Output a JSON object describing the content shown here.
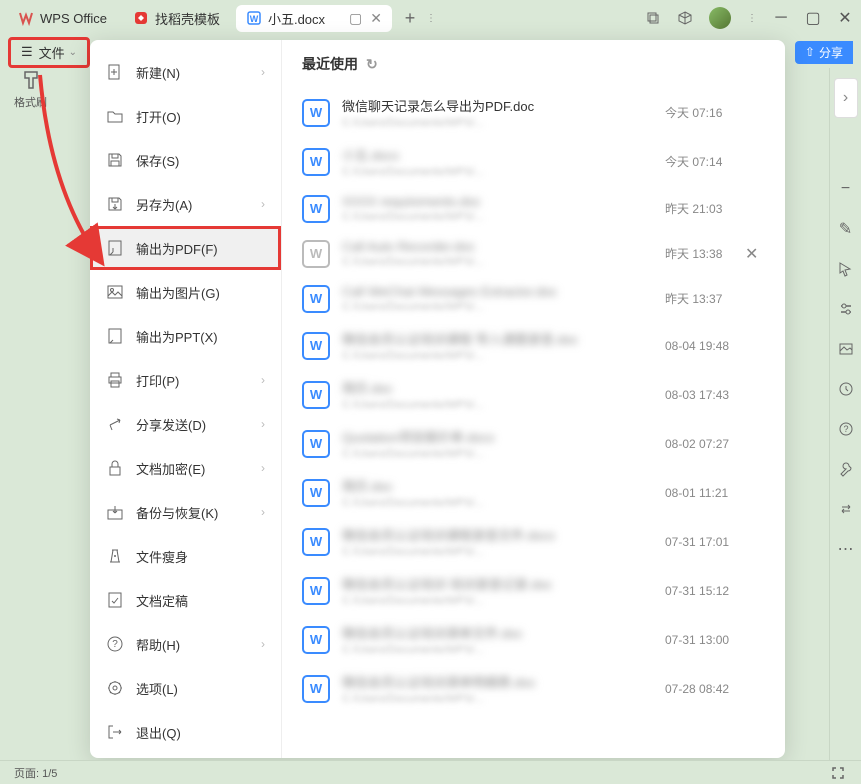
{
  "tabs": [
    {
      "label": "WPS Office",
      "icon": "wps"
    },
    {
      "label": "找稻壳模板",
      "icon": "docer"
    },
    {
      "label": "小五.docx",
      "icon": "doc",
      "active": true
    }
  ],
  "topbar": {
    "file_label": "文件",
    "share_label": "分享"
  },
  "toolbar": {
    "format_brush": "格式刷"
  },
  "menu": {
    "items": [
      {
        "label": "新建(N)",
        "icon": "new",
        "arrow": true
      },
      {
        "label": "打开(O)",
        "icon": "open"
      },
      {
        "label": "保存(S)",
        "icon": "save"
      },
      {
        "label": "另存为(A)",
        "icon": "saveas",
        "arrow": true
      },
      {
        "label": "输出为PDF(F)",
        "icon": "pdf",
        "highlight": true
      },
      {
        "label": "输出为图片(G)",
        "icon": "img"
      },
      {
        "label": "输出为PPT(X)",
        "icon": "ppt"
      },
      {
        "label": "打印(P)",
        "icon": "print",
        "arrow": true
      },
      {
        "label": "分享发送(D)",
        "icon": "share",
        "arrow": true
      },
      {
        "label": "文档加密(E)",
        "icon": "lock",
        "arrow": true
      },
      {
        "label": "备份与恢复(K)",
        "icon": "backup",
        "arrow": true
      },
      {
        "label": "文件瘦身",
        "icon": "slim"
      },
      {
        "label": "文档定稿",
        "icon": "final"
      },
      {
        "label": "帮助(H)",
        "icon": "help",
        "arrow": true
      },
      {
        "label": "选项(L)",
        "icon": "opts"
      },
      {
        "label": "退出(Q)",
        "icon": "exit"
      }
    ]
  },
  "recent": {
    "title": "最近使用",
    "files": [
      {
        "name": "微信聊天记录怎么导出为PDF.doc",
        "time": "今天 07:16",
        "clear": true
      },
      {
        "name": "小五.docx",
        "time": "今天 07:14"
      },
      {
        "name": "XXXX requirements.doc",
        "time": "昨天 21:03"
      },
      {
        "name": "Call Auto Recorder.doc",
        "time": "昨天 13:38",
        "gray": true,
        "close": true
      },
      {
        "name": "Call WeChat Messages Extractor.doc",
        "time": "昨天 13:37"
      },
      {
        "name": "微信会员认证培训课程 导入课题录音.doc",
        "time": "08-04 19:48"
      },
      {
        "name": "简历.doc",
        "time": "08-03 17:43"
      },
      {
        "name": "Quotation项目报价单.docx",
        "time": "08-02 07:27"
      },
      {
        "name": "简历.doc",
        "time": "08-01 11:21"
      },
      {
        "name": "微信会员认证培训课程录音文件.docx",
        "time": "07-31 17:01"
      },
      {
        "name": "微信会员认证培训 培训录音记录.doc",
        "time": "07-31 15:12"
      },
      {
        "name": "微信会员认证培训清单文件.doc",
        "time": "07-31 13:00"
      },
      {
        "name": "微信会员认证培训清单明细表.doc",
        "time": "07-28 08:42"
      }
    ]
  },
  "status": {
    "page": "页面: 1/5"
  }
}
